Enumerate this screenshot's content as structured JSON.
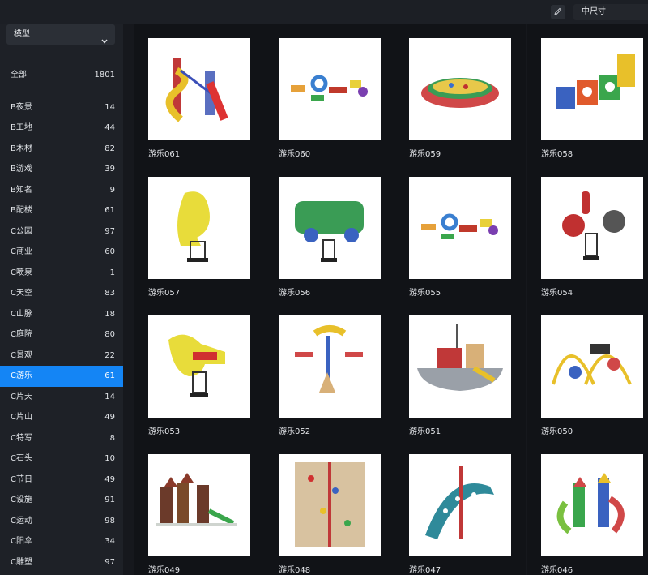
{
  "toolbar": {
    "size_option": "中尺寸"
  },
  "sidebar": {
    "model_select": "模型",
    "categories": [
      {
        "label": "全部",
        "count": "1801"
      },
      {
        "label": "B夜景",
        "count": "14"
      },
      {
        "label": "B工地",
        "count": "44"
      },
      {
        "label": "B木材",
        "count": "82"
      },
      {
        "label": "B游戏",
        "count": "39"
      },
      {
        "label": "B知名",
        "count": "9"
      },
      {
        "label": "B配楼",
        "count": "61"
      },
      {
        "label": "C公园",
        "count": "97"
      },
      {
        "label": "C商业",
        "count": "60"
      },
      {
        "label": "C喷泉",
        "count": "1"
      },
      {
        "label": "C天空",
        "count": "83"
      },
      {
        "label": "C山脉",
        "count": "18"
      },
      {
        "label": "C庭院",
        "count": "80"
      },
      {
        "label": "C景观",
        "count": "22"
      },
      {
        "label": "C游乐",
        "count": "61"
      },
      {
        "label": "C片天",
        "count": "14"
      },
      {
        "label": "C片山",
        "count": "49"
      },
      {
        "label": "C特写",
        "count": "8"
      },
      {
        "label": "C石头",
        "count": "10"
      },
      {
        "label": "C节日",
        "count": "49"
      },
      {
        "label": "C设施",
        "count": "91"
      },
      {
        "label": "C运动",
        "count": "98"
      },
      {
        "label": "C阳伞",
        "count": "34"
      },
      {
        "label": "C雕塑",
        "count": "97"
      }
    ],
    "active_category": "C游乐"
  },
  "grid": {
    "items": [
      {
        "label": "游乐061",
        "icon": "playground-slide-tower-icon"
      },
      {
        "label": "游乐060",
        "icon": "foam-blocks-icon"
      },
      {
        "label": "游乐059",
        "icon": "ball-pit-icon"
      },
      {
        "label": "游乐058",
        "icon": "climbing-cubes-icon"
      },
      {
        "label": "游乐057",
        "icon": "seahorse-spring-rider-icon"
      },
      {
        "label": "游乐056",
        "icon": "car-spring-rider-icon"
      },
      {
        "label": "游乐055",
        "icon": "foam-blocks-icon"
      },
      {
        "label": "游乐054",
        "icon": "motorbike-spring-rider-icon"
      },
      {
        "label": "游乐053",
        "icon": "horse-spring-rider-icon"
      },
      {
        "label": "游乐052",
        "icon": "spinning-seat-icon"
      },
      {
        "label": "游乐051",
        "icon": "pirate-ship-icon"
      },
      {
        "label": "游乐050",
        "icon": "climbing-arch-icon"
      },
      {
        "label": "游乐049",
        "icon": "playground-complex-icon"
      },
      {
        "label": "游乐048",
        "icon": "climbing-wall-icon"
      },
      {
        "label": "游乐047",
        "icon": "curved-climber-icon"
      },
      {
        "label": "游乐046",
        "icon": "slide-complex-icon"
      }
    ]
  }
}
